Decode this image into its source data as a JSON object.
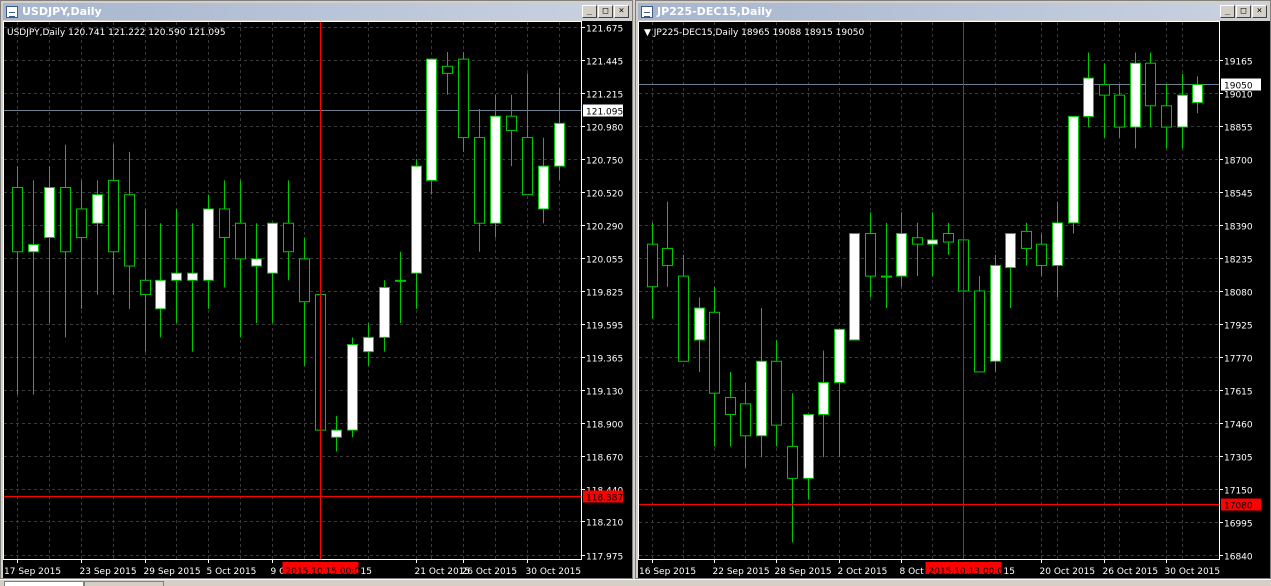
{
  "colors": {
    "bg": "#000000",
    "grid": "#3a3a3a",
    "bull_fill": "#ffffff",
    "bear_fill": "#000000",
    "wick": "#00c800",
    "axis_text": "#ffffff",
    "crosshair": "#ff0000",
    "bid_line": "#708090",
    "time_label_bg": "#ff0000"
  },
  "title_buttons": [
    "_",
    "□",
    "×"
  ],
  "chart_data": [
    {
      "type": "candlestick",
      "window_title": "USDJPY,Daily",
      "info": "USDJPY,Daily  120.741 121.222 120.590 121.095",
      "ylim": [
        117.975,
        121.675
      ],
      "price_ticks": [
        "121.675",
        "121.445",
        "121.215",
        "120.980",
        "120.750",
        "120.520",
        "120.290",
        "120.055",
        "119.825",
        "119.595",
        "119.365",
        "119.130",
        "118.900",
        "118.670",
        "118.440",
        "118.210",
        "117.975"
      ],
      "x_labels": [
        "17 Sep 2015",
        "23 Sep 2015",
        "29 Sep 2015",
        "5 Oct 2015",
        "9 Oct",
        "21 Oct 2015",
        "26 Oct 2015",
        "30 Oct 2015"
      ],
      "x_label_bars": [
        0,
        4,
        8,
        12,
        16,
        25,
        28,
        32
      ],
      "current_price": "121.095",
      "cross_price": "118.387",
      "cross_time": "2015.10.15 00:00",
      "cross_time_suffix": "15",
      "cross_bar": 19,
      "ohlc": [
        [
          120.55,
          120.7,
          119.1,
          120.1
        ],
        [
          120.1,
          120.6,
          119.1,
          120.15
        ],
        [
          120.2,
          120.7,
          119.6,
          120.55
        ],
        [
          120.55,
          120.85,
          119.5,
          120.1
        ],
        [
          120.4,
          120.6,
          119.7,
          120.2
        ],
        [
          120.3,
          120.6,
          119.8,
          120.5
        ],
        [
          120.6,
          120.85,
          119.8,
          120.1
        ],
        [
          120.5,
          120.8,
          119.7,
          120.0
        ],
        [
          119.9,
          120.4,
          119.4,
          119.8
        ],
        [
          119.7,
          120.3,
          119.5,
          119.9
        ],
        [
          119.9,
          120.4,
          119.6,
          119.95
        ],
        [
          119.9,
          120.3,
          119.4,
          119.95
        ],
        [
          119.9,
          120.5,
          119.7,
          120.4
        ],
        [
          120.4,
          120.6,
          119.85,
          120.2
        ],
        [
          120.3,
          120.6,
          119.5,
          120.05
        ],
        [
          120.0,
          120.3,
          119.6,
          120.05
        ],
        [
          119.95,
          120.2,
          119.6,
          120.3
        ],
        [
          120.3,
          120.6,
          119.9,
          120.1
        ],
        [
          120.05,
          120.2,
          119.3,
          119.75
        ],
        [
          119.8,
          119.9,
          118.7,
          118.85
        ],
        [
          118.8,
          118.95,
          118.7,
          118.85
        ],
        [
          118.85,
          119.5,
          118.8,
          119.45
        ],
        [
          119.4,
          119.6,
          119.3,
          119.5
        ],
        [
          119.5,
          119.9,
          119.4,
          119.85
        ],
        [
          119.9,
          120.1,
          119.6,
          119.9
        ],
        [
          119.95,
          120.75,
          119.7,
          120.7
        ],
        [
          120.6,
          121.45,
          120.5,
          121.45
        ],
        [
          121.4,
          121.5,
          121.2,
          121.35
        ],
        [
          121.45,
          121.5,
          120.8,
          120.9
        ],
        [
          120.9,
          121.1,
          120.1,
          120.3
        ],
        [
          120.3,
          121.2,
          120.2,
          121.05
        ],
        [
          121.05,
          121.2,
          120.7,
          120.95
        ],
        [
          120.9,
          121.35,
          120.5,
          120.5
        ],
        [
          120.4,
          120.9,
          120.3,
          120.7
        ],
        [
          120.7,
          121.25,
          120.6,
          121.0
        ]
      ]
    },
    {
      "type": "candlestick",
      "window_title": "JP225-DEC15,Daily",
      "info": "JP225-DEC15,Daily  18965 19088 18915 19050",
      "ylim": [
        16840,
        19320
      ],
      "price_ticks": [
        "19165",
        "19010",
        "18855",
        "18700",
        "18545",
        "18390",
        "18235",
        "18080",
        "17925",
        "17770",
        "17615",
        "17460",
        "17305",
        "17150",
        "16995",
        "16840"
      ],
      "x_labels": [
        "16 Sep 2015",
        "22 Sep 2015",
        "28 Sep 2015",
        "2 Oct 2015",
        "8 Oct",
        "20 Oct 2015",
        "26 Oct 2015",
        "30 Oct 2015"
      ],
      "x_label_bars": [
        0,
        4,
        8,
        12,
        16,
        25,
        29,
        33
      ],
      "current_price": "19050",
      "cross_price": "17080",
      "cross_time": "2015.10.13 00:00",
      "cross_time_suffix": "15",
      "cross_bar": 20,
      "ohlc": [
        [
          18300,
          18400,
          17950,
          18100
        ],
        [
          18280,
          18500,
          18100,
          18200
        ],
        [
          18150,
          18250,
          17750,
          17750
        ],
        [
          17850,
          18050,
          17700,
          18000
        ],
        [
          17980,
          18100,
          17350,
          17600
        ],
        [
          17580,
          17700,
          17350,
          17500
        ],
        [
          17550,
          17650,
          17250,
          17400
        ],
        [
          17400,
          18000,
          17300,
          17750
        ],
        [
          17750,
          17850,
          17350,
          17450
        ],
        [
          17350,
          17600,
          16900,
          17200
        ],
        [
          17200,
          17480,
          17100,
          17500
        ],
        [
          17500,
          17800,
          17300,
          17650
        ],
        [
          17650,
          17900,
          17300,
          17900
        ],
        [
          17850,
          18350,
          17850,
          18350
        ],
        [
          18350,
          18450,
          18050,
          18150
        ],
        [
          18150,
          18400,
          18000,
          18150
        ],
        [
          18150,
          18450,
          18100,
          18350
        ],
        [
          18330,
          18400,
          18150,
          18300
        ],
        [
          18300,
          18450,
          18150,
          18320
        ],
        [
          18350,
          18400,
          18250,
          18310
        ],
        [
          18320,
          18380,
          18050,
          18080
        ],
        [
          18080,
          18150,
          17700,
          17700
        ],
        [
          17750,
          18250,
          17700,
          18200
        ],
        [
          18190,
          18350,
          18000,
          18350
        ],
        [
          18360,
          18400,
          18200,
          18280
        ],
        [
          18300,
          18350,
          18150,
          18200
        ],
        [
          18200,
          18500,
          18050,
          18400
        ],
        [
          18400,
          18900,
          18350,
          18900
        ],
        [
          18900,
          19200,
          18850,
          19080
        ],
        [
          19050,
          19150,
          18800,
          19000
        ],
        [
          19000,
          19050,
          18800,
          18850
        ],
        [
          18850,
          19200,
          18750,
          19150
        ],
        [
          19150,
          19200,
          18850,
          18950
        ],
        [
          18950,
          19050,
          18750,
          18850
        ],
        [
          18850,
          19100,
          18750,
          19000
        ],
        [
          18965,
          19088,
          18915,
          19050
        ]
      ]
    }
  ]
}
